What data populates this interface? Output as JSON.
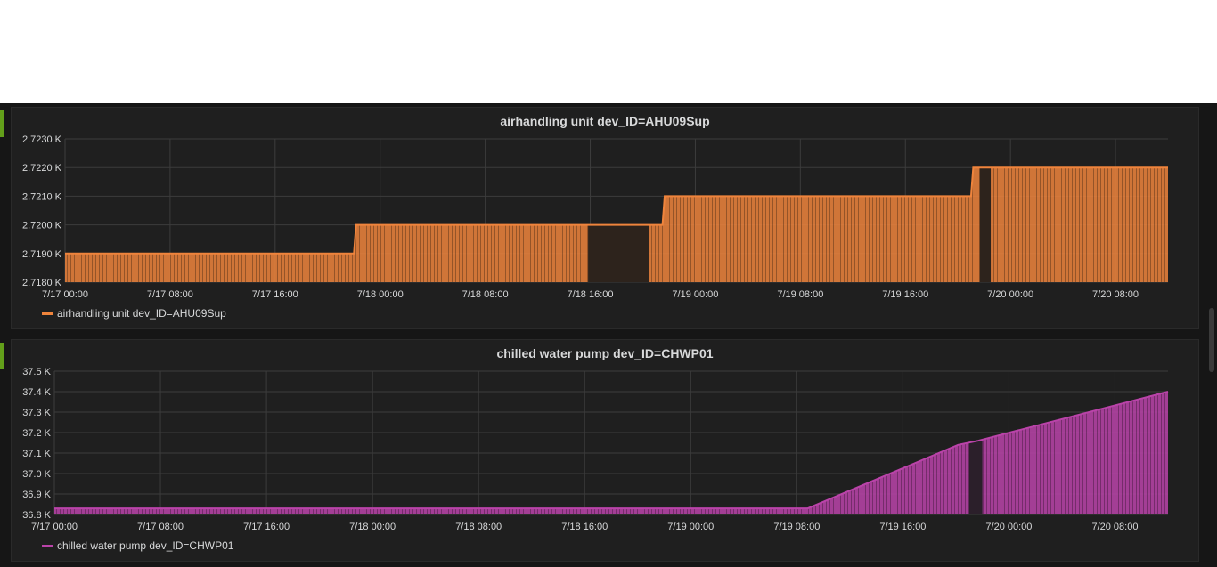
{
  "colors": {
    "panel_marker": "#629e1a",
    "grid": "#3c3c3c"
  },
  "chart_data": [
    {
      "type": "area",
      "title": "airhandling unit dev_ID=AHU09Sup",
      "xlabel": "",
      "ylabel": "",
      "x_ticks": [
        "7/17 00:00",
        "7/17 08:00",
        "7/17 16:00",
        "7/18 00:00",
        "7/18 08:00",
        "7/18 16:00",
        "7/19 00:00",
        "7/19 08:00",
        "7/19 16:00",
        "7/20 00:00",
        "7/20 08:00"
      ],
      "y_ticks": [
        "2.7180 K",
        "2.7190 K",
        "2.7200 K",
        "2.7210 K",
        "2.7220 K",
        "2.7230 K"
      ],
      "ylim": [
        2718,
        2723
      ],
      "xlim_hours": [
        0,
        84
      ],
      "grid": true,
      "legend_position": "bottom-left",
      "series": [
        {
          "name": "airhandling unit dev_ID=AHU09Sup",
          "color": "#ef843c",
          "points": [
            {
              "t": "7/17 00:00",
              "v": 2719
            },
            {
              "t": "7/17 22:00",
              "v": 2719
            },
            {
              "t": "7/17 22:10",
              "v": 2720
            },
            {
              "t": "7/18 15:50",
              "v": 2720
            },
            {
              "t": "7/18 20:30",
              "v": 2720
            },
            {
              "t": "7/18 21:30",
              "v": 2720
            },
            {
              "t": "7/18 21:40",
              "v": 2721
            },
            {
              "t": "7/19 21:00",
              "v": 2721
            },
            {
              "t": "7/19 21:10",
              "v": 2722
            },
            {
              "t": "7/20 12:00",
              "v": 2722
            }
          ],
          "gaps": [
            {
              "start": "7/18 15:50",
              "end": "7/18 20:30"
            },
            {
              "start": "7/19 21:40",
              "end": "7/19 22:30"
            }
          ]
        }
      ]
    },
    {
      "type": "area",
      "title": "chilled water pump dev_ID=CHWP01",
      "xlabel": "",
      "ylabel": "",
      "x_ticks": [
        "7/17 00:00",
        "7/17 08:00",
        "7/17 16:00",
        "7/18 00:00",
        "7/18 08:00",
        "7/18 16:00",
        "7/19 00:00",
        "7/19 08:00",
        "7/19 16:00",
        "7/20 00:00",
        "7/20 08:00"
      ],
      "y_ticks": [
        "36.8 K",
        "36.9 K",
        "37.0 K",
        "37.1 K",
        "37.2 K",
        "37.3 K",
        "37.4 K",
        "37.5 K"
      ],
      "ylim": [
        36800,
        37500
      ],
      "xlim_hours": [
        0,
        84
      ],
      "grid": true,
      "legend_position": "bottom-left",
      "series": [
        {
          "name": "chilled water pump dev_ID=CHWP01",
          "color": "#ba43a9",
          "points": [
            {
              "t": "7/17 00:00",
              "v": 36830
            },
            {
              "t": "7/18 16:00",
              "v": 36830
            },
            {
              "t": "7/18 20:50",
              "v": 36830
            },
            {
              "t": "7/19 08:50",
              "v": 36830
            },
            {
              "t": "7/19 20:10",
              "v": 37140
            },
            {
              "t": "7/19 21:40",
              "v": 37160
            },
            {
              "t": "7/20 12:00",
              "v": 37400
            }
          ],
          "gaps": [
            {
              "start": "7/19 21:00",
              "end": "7/19 22:00"
            }
          ]
        }
      ]
    }
  ]
}
